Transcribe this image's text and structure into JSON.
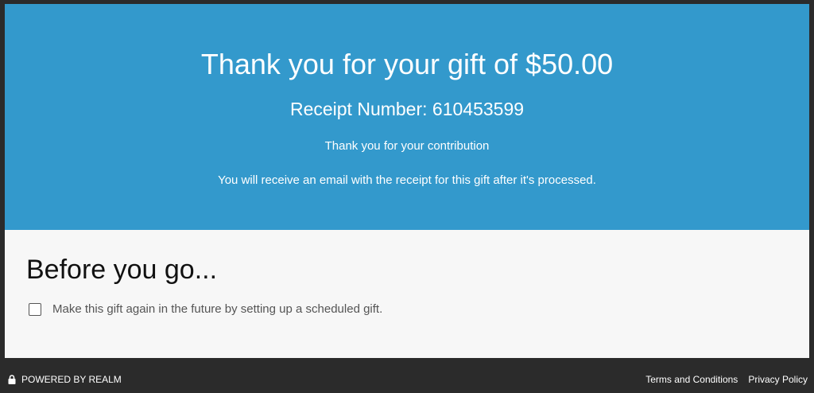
{
  "confirmation": {
    "title": "Thank you for your gift of $50.00",
    "receipt": "Receipt Number: 610453599",
    "thanks": "Thank you for your contribution",
    "email_note": "You will receive an email with the receipt for this gift after it's processed."
  },
  "before_you_go": {
    "heading": "Before you go...",
    "scheduled_gift_label": "Make this gift again in the future by setting up a scheduled gift.",
    "scheduled_gift_checked": false
  },
  "footer": {
    "powered_by": "POWERED BY REALM",
    "lock_icon": "lock-icon",
    "links": [
      "Terms and Conditions",
      "Privacy Policy"
    ]
  },
  "colors": {
    "hero_background": "#3399cc",
    "panel_background": "#f7f7f7",
    "frame_background": "#2b2b2b"
  }
}
